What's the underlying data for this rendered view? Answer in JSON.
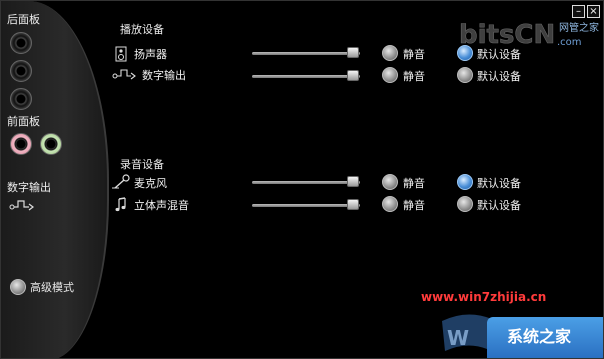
{
  "left_panel": {
    "rear_panel_label": "后面板",
    "front_panel_label": "前面板",
    "digital_out_label": "数字输出",
    "advanced_mode_label": "高级模式"
  },
  "playback": {
    "section_title": "播放设备",
    "devices": [
      {
        "name": "扬声器",
        "icon": "speaker-icon",
        "volume": 0.95,
        "mute_label": "静音",
        "mute_selected": false,
        "default_label": "默认设备",
        "default_selected": true
      },
      {
        "name": "数字输出",
        "icon": "digital-out-icon",
        "volume": 0.95,
        "mute_label": "静音",
        "mute_selected": false,
        "default_label": "默认设备",
        "default_selected": false
      }
    ]
  },
  "recording": {
    "section_title": "录音设备",
    "devices": [
      {
        "name": "麦克风",
        "icon": "microphone-icon",
        "volume": 0.95,
        "mute_label": "静音",
        "mute_selected": false,
        "default_label": "默认设备",
        "default_selected": true
      },
      {
        "name": "立体声混音",
        "icon": "music-note-icon",
        "volume": 0.95,
        "mute_label": "静音",
        "mute_selected": false,
        "default_label": "默认设备",
        "default_selected": false
      }
    ]
  },
  "window_buttons": {
    "minimize": "–",
    "close": "×"
  },
  "watermarks": {
    "top_right": "bitsCN.com",
    "top_right_sub": "网管之家",
    "bottom_url": "www.win7zhijia.cn",
    "bottom_right": "系统之家"
  },
  "colors": {
    "selected_radio": "#4a8fd8",
    "background": "#000000",
    "watermark_red": "#ff3b3b"
  }
}
